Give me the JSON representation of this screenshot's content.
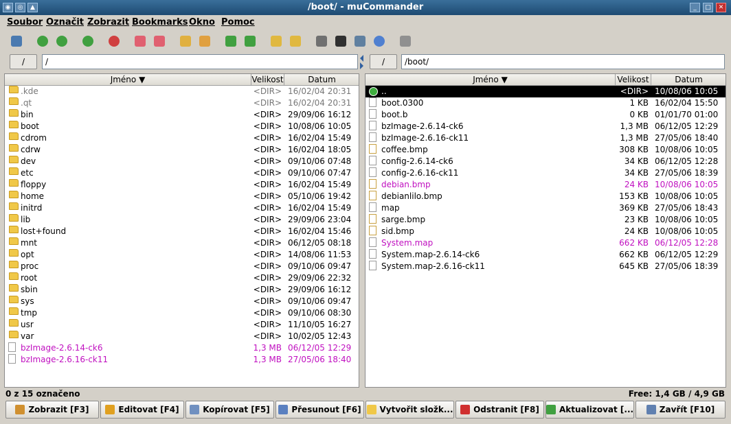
{
  "window": {
    "title": "/boot/ - muCommander"
  },
  "menu": [
    "Soubor",
    "Označit",
    "Zobrazit",
    "Bookmarks",
    "Okno",
    "Pomoc"
  ],
  "left": {
    "root_label": "/",
    "path": "/",
    "columns": {
      "name": "Jméno",
      "size": "Velikost",
      "date": "Datum"
    },
    "rows": [
      {
        "name": ".kde",
        "size": "<DIR>",
        "date": "16/02/04 20:31",
        "type": "folder",
        "style": "grey"
      },
      {
        "name": ".qt",
        "size": "<DIR>",
        "date": "16/02/04 20:31",
        "type": "folder",
        "style": "grey"
      },
      {
        "name": "bin",
        "size": "<DIR>",
        "date": "29/09/06 16:12",
        "type": "folder",
        "style": ""
      },
      {
        "name": "boot",
        "size": "<DIR>",
        "date": "10/08/06 10:05",
        "type": "folder",
        "style": ""
      },
      {
        "name": "cdrom",
        "size": "<DIR>",
        "date": "16/02/04 15:49",
        "type": "folder",
        "style": ""
      },
      {
        "name": "cdrw",
        "size": "<DIR>",
        "date": "16/02/04 18:05",
        "type": "folder",
        "style": ""
      },
      {
        "name": "dev",
        "size": "<DIR>",
        "date": "09/10/06 07:48",
        "type": "folder",
        "style": ""
      },
      {
        "name": "etc",
        "size": "<DIR>",
        "date": "09/10/06 07:47",
        "type": "folder",
        "style": ""
      },
      {
        "name": "floppy",
        "size": "<DIR>",
        "date": "16/02/04 15:49",
        "type": "folder",
        "style": ""
      },
      {
        "name": "home",
        "size": "<DIR>",
        "date": "05/10/06 19:42",
        "type": "folder",
        "style": ""
      },
      {
        "name": "initrd",
        "size": "<DIR>",
        "date": "16/02/04 15:49",
        "type": "folder",
        "style": ""
      },
      {
        "name": "lib",
        "size": "<DIR>",
        "date": "29/09/06 23:04",
        "type": "folder",
        "style": ""
      },
      {
        "name": "lost+found",
        "size": "<DIR>",
        "date": "16/02/04 15:46",
        "type": "folder",
        "style": ""
      },
      {
        "name": "mnt",
        "size": "<DIR>",
        "date": "06/12/05 08:18",
        "type": "folder",
        "style": ""
      },
      {
        "name": "opt",
        "size": "<DIR>",
        "date": "14/08/06 11:53",
        "type": "folder",
        "style": ""
      },
      {
        "name": "proc",
        "size": "<DIR>",
        "date": "09/10/06 09:47",
        "type": "folder",
        "style": ""
      },
      {
        "name": "root",
        "size": "<DIR>",
        "date": "29/09/06 22:32",
        "type": "folder",
        "style": ""
      },
      {
        "name": "sbin",
        "size": "<DIR>",
        "date": "29/09/06 16:12",
        "type": "folder",
        "style": ""
      },
      {
        "name": "sys",
        "size": "<DIR>",
        "date": "09/10/06 09:47",
        "type": "folder",
        "style": ""
      },
      {
        "name": "tmp",
        "size": "<DIR>",
        "date": "09/10/06 08:30",
        "type": "folder",
        "style": ""
      },
      {
        "name": "usr",
        "size": "<DIR>",
        "date": "11/10/05 16:27",
        "type": "folder",
        "style": ""
      },
      {
        "name": "var",
        "size": "<DIR>",
        "date": "10/02/05 12:43",
        "type": "folder",
        "style": ""
      },
      {
        "name": "bzImage-2.6.14-ck6",
        "size": "1,3 MB",
        "date": "06/12/05 12:29",
        "type": "file",
        "style": "magenta"
      },
      {
        "name": "bzImage-2.6.16-ck11",
        "size": "1,3 MB",
        "date": "27/05/06 18:40",
        "type": "file",
        "style": "magenta"
      }
    ],
    "status": "0 z 15 označeno"
  },
  "right": {
    "root_label": "/",
    "path": "/boot/",
    "columns": {
      "name": "Jméno",
      "size": "Velikost",
      "date": "Datum"
    },
    "rows": [
      {
        "name": "..",
        "size": "<DIR>",
        "date": "10/08/06 10:05",
        "type": "up",
        "style": "sel"
      },
      {
        "name": "boot.0300",
        "size": "1 KB",
        "date": "16/02/04 15:50",
        "type": "file",
        "style": ""
      },
      {
        "name": "boot.b",
        "size": "0 KB",
        "date": "01/01/70 01:00",
        "type": "file",
        "style": ""
      },
      {
        "name": "bzImage-2.6.14-ck6",
        "size": "1,3 MB",
        "date": "06/12/05 12:29",
        "type": "file",
        "style": ""
      },
      {
        "name": "bzImage-2.6.16-ck11",
        "size": "1,3 MB",
        "date": "27/05/06 18:40",
        "type": "file",
        "style": ""
      },
      {
        "name": "coffee.bmp",
        "size": "308 KB",
        "date": "10/08/06 10:05",
        "type": "image",
        "style": ""
      },
      {
        "name": "config-2.6.14-ck6",
        "size": "34 KB",
        "date": "06/12/05 12:28",
        "type": "file",
        "style": ""
      },
      {
        "name": "config-2.6.16-ck11",
        "size": "34 KB",
        "date": "27/05/06 18:39",
        "type": "file",
        "style": ""
      },
      {
        "name": "debian.bmp",
        "size": "24 KB",
        "date": "10/08/06 10:05",
        "type": "image",
        "style": "magenta"
      },
      {
        "name": "debianlilo.bmp",
        "size": "153 KB",
        "date": "10/08/06 10:05",
        "type": "image",
        "style": ""
      },
      {
        "name": "map",
        "size": "369 KB",
        "date": "27/05/06 18:43",
        "type": "file",
        "style": ""
      },
      {
        "name": "sarge.bmp",
        "size": "23 KB",
        "date": "10/08/06 10:05",
        "type": "image",
        "style": ""
      },
      {
        "name": "sid.bmp",
        "size": "24 KB",
        "date": "10/08/06 10:05",
        "type": "image",
        "style": ""
      },
      {
        "name": "System.map",
        "size": "662 KB",
        "date": "06/12/05 12:28",
        "type": "file",
        "style": "magenta"
      },
      {
        "name": "System.map-2.6.14-ck6",
        "size": "662 KB",
        "date": "06/12/05 12:29",
        "type": "file",
        "style": ""
      },
      {
        "name": "System.map-2.6.16-ck11",
        "size": "645 KB",
        "date": "27/05/06 18:39",
        "type": "file",
        "style": ""
      }
    ],
    "status": "Free: 1,4 GB / 4,9 GB"
  },
  "commands": [
    {
      "label": "Zobrazit [F3]",
      "icon": "magnifier-icon",
      "color": "#d09030"
    },
    {
      "label": "Editovat [F4]",
      "icon": "pencil-icon",
      "color": "#e0a020"
    },
    {
      "label": "Kopírovat [F5]",
      "icon": "copy-icon",
      "color": "#7090c0"
    },
    {
      "label": "Přesunout [F6]",
      "icon": "move-icon",
      "color": "#5a80c0"
    },
    {
      "label": "Vytvořit složk...",
      "icon": "new-folder-icon",
      "color": "#f0c848"
    },
    {
      "label": "Odstranit [F8]",
      "icon": "delete-icon",
      "color": "#d03030"
    },
    {
      "label": "Aktualizovat [...",
      "icon": "refresh-icon",
      "color": "#40a040"
    },
    {
      "label": "Zavřít [F10]",
      "icon": "close-window-icon",
      "color": "#6080b0"
    }
  ],
  "toolbar": [
    {
      "icon": "new-window-icon",
      "color": "#4a7ab0"
    },
    {
      "icon": "back-icon",
      "color": "#40a040"
    },
    {
      "icon": "forward-icon",
      "color": "#40a040"
    },
    {
      "icon": "parent-folder-icon",
      "color": "#40a040"
    },
    {
      "icon": "stop-icon",
      "color": "#d04040"
    },
    {
      "icon": "add-bookmark-icon",
      "color": "#e06070"
    },
    {
      "icon": "bookmarks-icon",
      "color": "#e06070"
    },
    {
      "icon": "connect-icon",
      "color": "#e0b040"
    },
    {
      "icon": "disconnect-icon",
      "color": "#e0a040"
    },
    {
      "icon": "swap-panels-icon",
      "color": "#40a040"
    },
    {
      "icon": "set-same-folder-icon",
      "color": "#40a040"
    },
    {
      "icon": "pack-icon",
      "color": "#e0b840"
    },
    {
      "icon": "unpack-icon",
      "color": "#e0b840"
    },
    {
      "icon": "run-command-icon",
      "color": "#707070"
    },
    {
      "icon": "terminal-icon",
      "color": "#303030"
    },
    {
      "icon": "email-icon",
      "color": "#6080a0"
    },
    {
      "icon": "properties-icon",
      "color": "#5080d0"
    },
    {
      "icon": "preferences-icon",
      "color": "#909090"
    }
  ]
}
